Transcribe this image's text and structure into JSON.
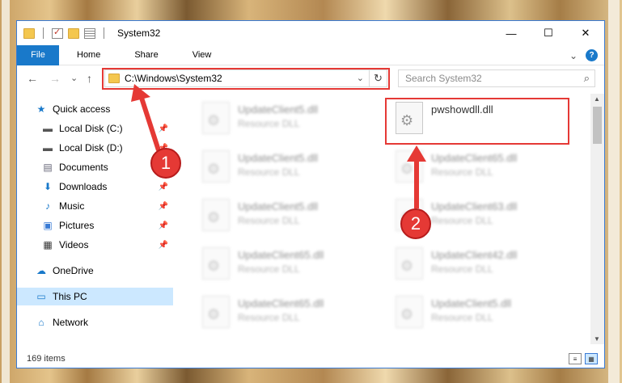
{
  "window": {
    "title": "System32",
    "controls": {
      "minimize": "—",
      "maximize": "☐",
      "close": "✕"
    }
  },
  "ribbon": {
    "file_tab": "File",
    "tabs": [
      "Home",
      "Share",
      "View"
    ],
    "expand": "⌄",
    "help": "?"
  },
  "address": {
    "path": "C:\\Windows\\System32",
    "dropdown": "⌄",
    "refresh": "↻",
    "back": "←",
    "forward": "→",
    "recent": "⌄",
    "up": "↑"
  },
  "search": {
    "placeholder": "Search System32",
    "icon": "⌕"
  },
  "nav": {
    "items": [
      {
        "label": "Quick access",
        "icon": "★",
        "pinned": false
      },
      {
        "label": "Local Disk (C:)",
        "icon": "▬",
        "pinned": true
      },
      {
        "label": "Local Disk (D:)",
        "icon": "▬",
        "pinned": true
      },
      {
        "label": "Documents",
        "icon": "▤",
        "pinned": true
      },
      {
        "label": "Downloads",
        "icon": "⬇",
        "pinned": true
      },
      {
        "label": "Music",
        "icon": "♪",
        "pinned": true
      },
      {
        "label": "Pictures",
        "icon": "▣",
        "pinned": true
      },
      {
        "label": "Videos",
        "icon": "▦",
        "pinned": true
      },
      {
        "label": "OneDrive",
        "icon": "☁",
        "pinned": false
      },
      {
        "label": "This PC",
        "icon": "▭",
        "pinned": false,
        "selected": true
      },
      {
        "label": "Network",
        "icon": "⌂",
        "pinned": false
      }
    ],
    "pin_glyph": "📌"
  },
  "files": [
    {
      "name": "UpdateClient5.dll",
      "type": "Resource DLL",
      "blurred": true
    },
    {
      "name": "pwshowdll.dll",
      "type": "",
      "blurred": false
    },
    {
      "name": "UpdateClient5.dll",
      "type": "Resource DLL",
      "blurred": true
    },
    {
      "name": "UpdateClient65.dll",
      "type": "Resource DLL",
      "blurred": true
    },
    {
      "name": "UpdateClient5.dll",
      "type": "Resource DLL",
      "blurred": true
    },
    {
      "name": "UpdateClient63.dll",
      "type": "Resource DLL",
      "blurred": true
    },
    {
      "name": "UpdateClient65.dll",
      "type": "Resource DLL",
      "blurred": true
    },
    {
      "name": "UpdateClient42.dll",
      "type": "Resource DLL",
      "blurred": true
    },
    {
      "name": "UpdateClient65.dll",
      "type": "Resource DLL",
      "blurred": true
    },
    {
      "name": "UpdateClient5.dll",
      "type": "Resource DLL",
      "blurred": true
    }
  ],
  "status": {
    "count": "169 items"
  },
  "annotations": {
    "marker1": "1",
    "marker2": "2",
    "color": "#e53935"
  }
}
